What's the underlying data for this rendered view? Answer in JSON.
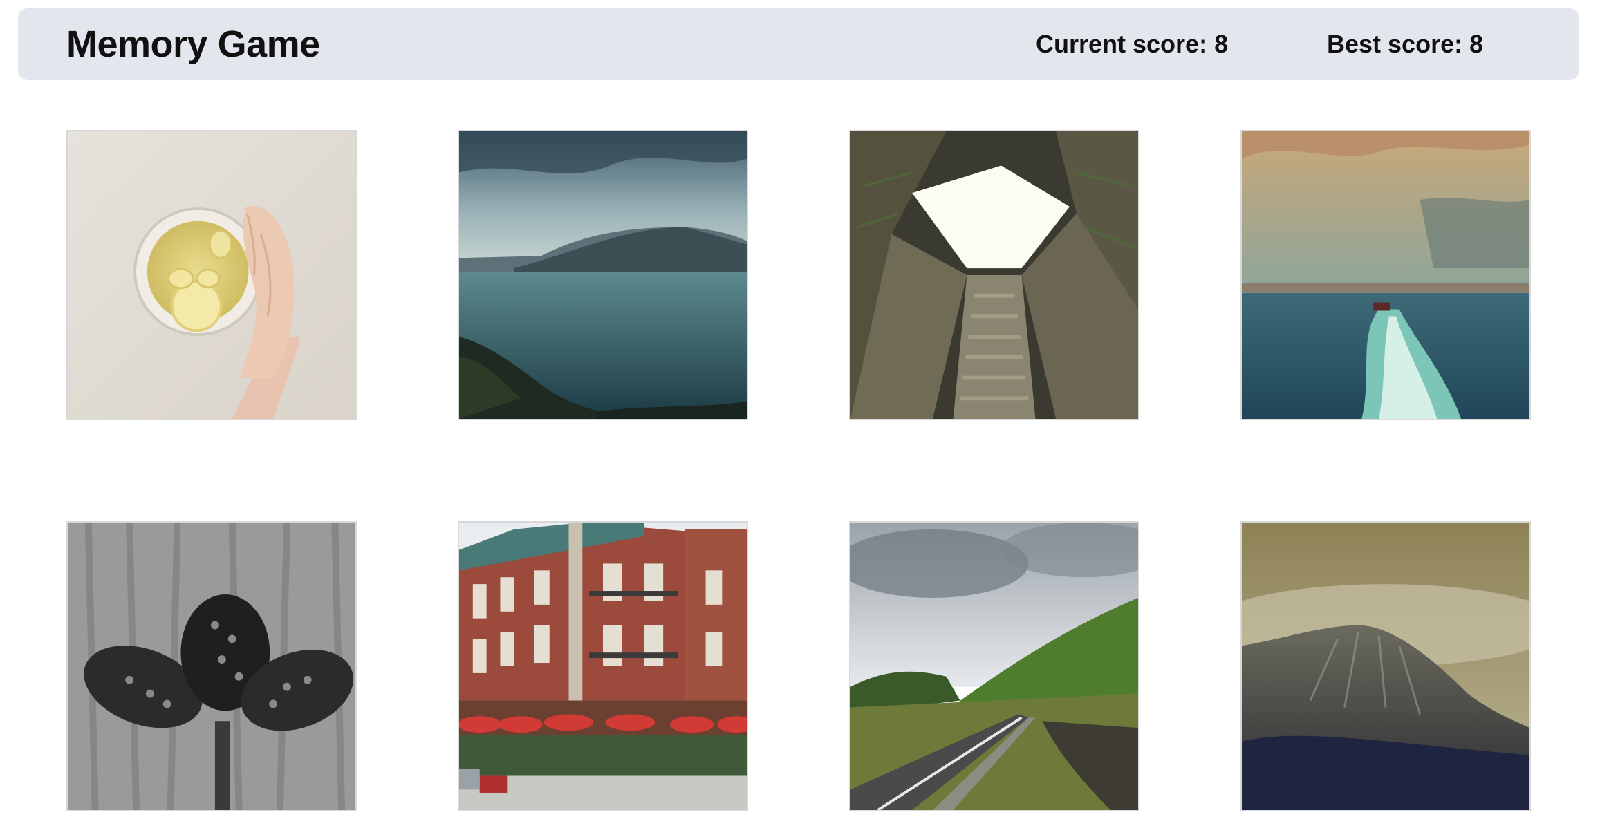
{
  "header": {
    "title": "Memory Game",
    "current_score": "Current score: 8",
    "best_score": "Best score: 8"
  },
  "cards": [
    {
      "subject": "hand holding cup of lemon ginger tea"
    },
    {
      "subject": "lake with mountains under cloudy sky"
    },
    {
      "subject": "looking up through high-rise courtyard"
    },
    {
      "subject": "boat wake on sea with city skyline"
    },
    {
      "subject": "black and white pine cones"
    },
    {
      "subject": "red brick corner building with cafe umbrellas"
    },
    {
      "subject": "road through green mountain valley"
    },
    {
      "subject": "misty mountain peak"
    }
  ]
}
